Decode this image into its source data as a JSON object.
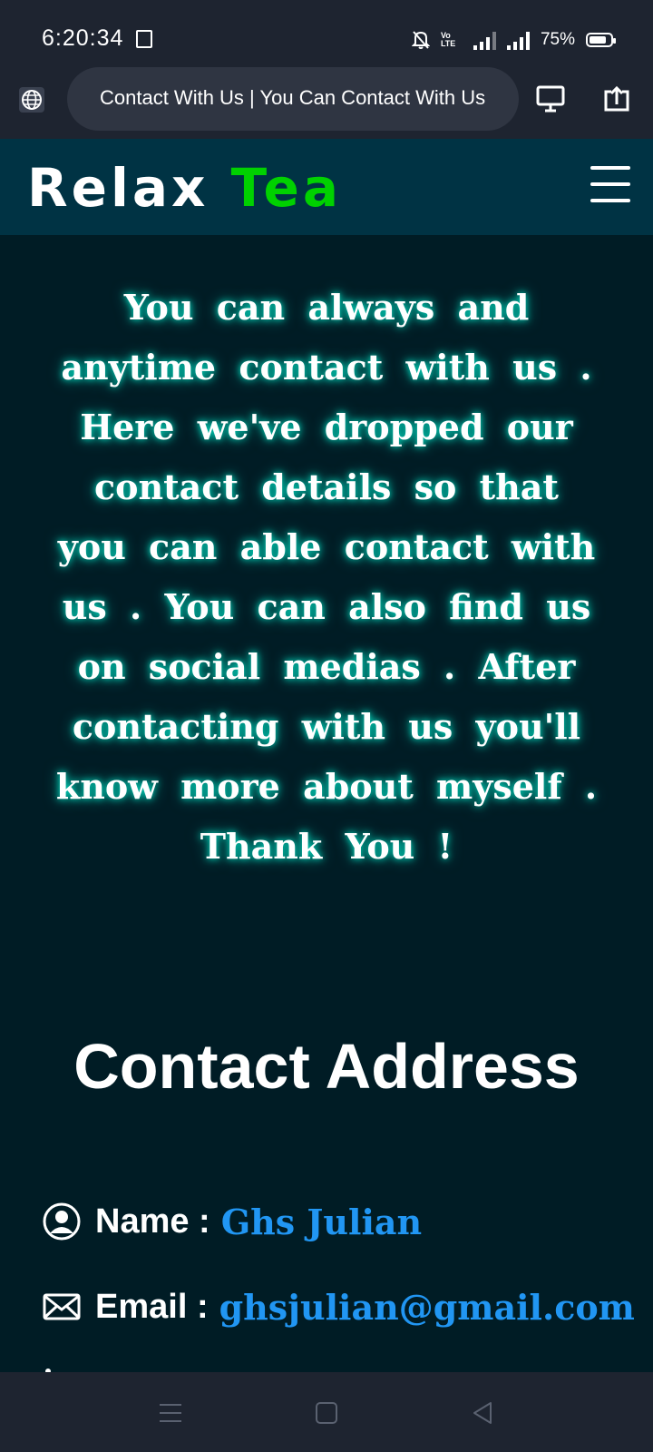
{
  "status_bar": {
    "time": "6:20:34",
    "network": "Vo LTE",
    "battery": "75%",
    "battery_level": 0.75
  },
  "browser": {
    "url_title": "Contact With Us | You Can Contact With Us"
  },
  "site": {
    "brand_part1": "Relax",
    "brand_part2": "Tea",
    "brand_color_1": "#ffffff",
    "brand_color_2": "#00d100"
  },
  "intro_text": "You can always and anytime contact with us . Here we've dropped our contact details so that you can able contact with us . You can also find us on social medias . After contacting with us you'll know more about myself . Thank You !",
  "contact": {
    "title": "Contact Address",
    "name_label": "Name :",
    "name_value": "Ghs Julian",
    "email_label": "Email :",
    "email_value": "ghsjulian@gmail.com",
    "value_color": "#2196f3"
  },
  "icons": {
    "globe": "globe-icon",
    "desktop": "desktop-icon",
    "share": "share-icon",
    "menu": "hamburger-icon",
    "user": "user-circle-icon",
    "mail": "mail-icon"
  }
}
